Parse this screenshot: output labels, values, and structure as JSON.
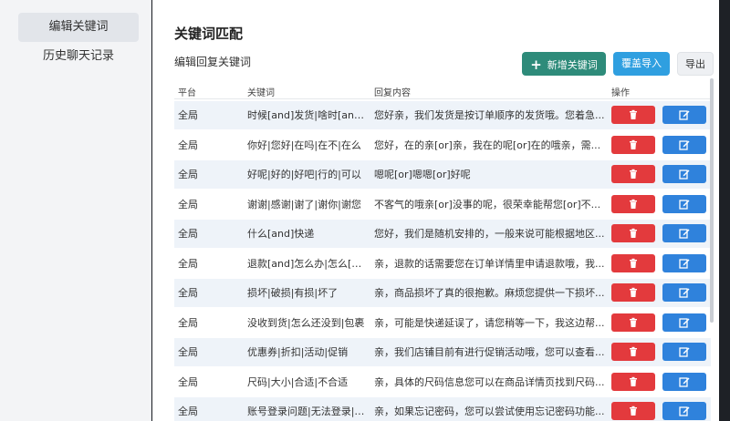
{
  "sidebar": {
    "items": [
      {
        "label": "编辑关键词",
        "active": true
      },
      {
        "label": "历史聊天记录",
        "active": false
      }
    ]
  },
  "main": {
    "title": "关键词匹配",
    "subtitle": "编辑回复关键词",
    "buttons": {
      "add": "新增关键词",
      "import": "覆盖导入",
      "export": "导出"
    },
    "table": {
      "headers": [
        "平台",
        "关键词",
        "回复内容",
        "操作"
      ],
      "rows": [
        {
          "platform": "全局",
          "keyword": "时候[and]发货|啥时[and]发货",
          "reply": "您好亲，我们发货是按订单顺序的发货哦。您着急..."
        },
        {
          "platform": "全局",
          "keyword": "你好|您好|在吗|在不|在么",
          "reply": "您好，在的亲[or]亲，我在的呢[or]在的哦亲，需..."
        },
        {
          "platform": "全局",
          "keyword": "好呢|好的|好吧|行的|可以",
          "reply": "嗯呢[or]嗯嗯[or]好呢"
        },
        {
          "platform": "全局",
          "keyword": "谢谢|感谢|谢了|谢你|谢您",
          "reply": "不客气的哦亲[or]没事的呢，很荣幸能帮您[or]不..."
        },
        {
          "platform": "全局",
          "keyword": "什么[and]快递",
          "reply": "您好，我们是随机安排的，一般来说可能根据地区..."
        },
        {
          "platform": "全局",
          "keyword": "退款[and]怎么办|怎么[and]退款",
          "reply": "亲，退款的话需要您在订单详情里申请退款哦，我..."
        },
        {
          "platform": "全局",
          "keyword": "损坏|破损|有损|坏了",
          "reply": "亲，商品损坏了真的很抱歉。麻烦您提供一下损坏..."
        },
        {
          "platform": "全局",
          "keyword": "没收到货|怎么还没到|包裹",
          "reply": "亲，可能是快递延误了，请您稍等一下，我这边帮..."
        },
        {
          "platform": "全局",
          "keyword": "优惠券|折扣|活动|促销",
          "reply": "亲，我们店铺目前有进行促销活动哦，您可以查看..."
        },
        {
          "platform": "全局",
          "keyword": "尺码|大小|合适|不合适",
          "reply": "亲，具体的尺码信息您可以在商品详情页找到尺码..."
        },
        {
          "platform": "全局",
          "keyword": "账号登录问题|无法登录|密码",
          "reply": "亲，如果忘记密码，您可以尝试使用忘记密码功能..."
        }
      ]
    }
  },
  "icons": {
    "delete": "trash-icon",
    "edit": "edit-icon",
    "add": "plus-icon"
  },
  "colors": {
    "add": "#2e8b7a",
    "import": "#2f9fe0",
    "delete": "#e33a3d",
    "edit": "#2f82dc",
    "row_alt": "#eef3f9"
  }
}
